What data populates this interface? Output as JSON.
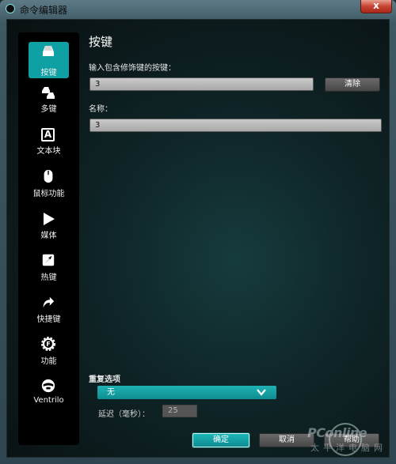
{
  "window": {
    "title": "命令编辑器",
    "close_glyph": "x"
  },
  "sidebar": {
    "items": [
      {
        "label": "按键",
        "icon": "keycap-icon",
        "active": true
      },
      {
        "label": "多键",
        "icon": "multikey-icon"
      },
      {
        "label": "文本块",
        "icon": "text-block-icon",
        "glyph": "A"
      },
      {
        "label": "鼠标功能",
        "icon": "mouse-icon"
      },
      {
        "label": "媒体",
        "icon": "play-icon"
      },
      {
        "label": "热键",
        "icon": "hotkey-icon"
      },
      {
        "label": "快捷键",
        "icon": "shortcut-arrow-icon"
      },
      {
        "label": "功能",
        "icon": "function-gear-icon",
        "glyph": "F"
      },
      {
        "label": "Ventrilo",
        "icon": "ventrilo-icon"
      }
    ]
  },
  "main": {
    "heading": "按键",
    "keystroke_label": "输入包含修饰键的按键：",
    "keystroke_value": "3",
    "clear_button": "清除",
    "name_label": "名称：",
    "name_value": "3",
    "repeat_label": "重复选项",
    "repeat_value": "无",
    "delay_label": "延迟（毫秒）：",
    "delay_value": "25"
  },
  "footer": {
    "ok": "确定",
    "cancel": "取消",
    "help": "帮助"
  },
  "watermark": {
    "brand": "PConline",
    "cn": "太平洋电脑网"
  },
  "colors": {
    "accent": "#0fa0a4",
    "sidebar_bg": "#000000"
  }
}
